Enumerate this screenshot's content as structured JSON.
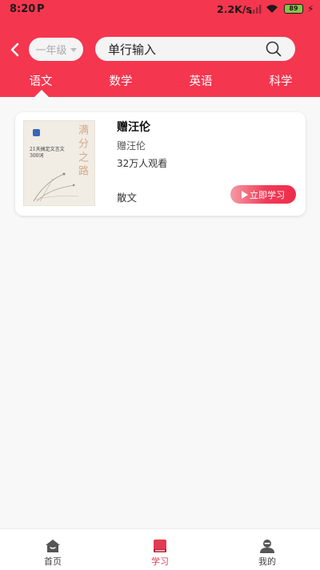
{
  "status_bar": {
    "time": "8:20",
    "carrier_icon": "P",
    "net_speed": "2.2K/s",
    "battery": "89"
  },
  "header": {
    "back_icon": "chevron-left-icon",
    "grade_select": {
      "value": "一年级"
    },
    "search": {
      "value": "单行输入",
      "icon": "search-icon"
    },
    "tabs": [
      {
        "label": "语文",
        "active": true
      },
      {
        "label": "数学",
        "active": false
      },
      {
        "label": "英语",
        "active": false
      },
      {
        "label": "科学",
        "active": false
      }
    ]
  },
  "course_card": {
    "title": "赠汪伦",
    "author": "赠汪伦",
    "views": "32万人观看",
    "genre": "散文",
    "button_label": "立即学习",
    "cover": {
      "title": "满分之路",
      "subtitle": "21天搞定文言文300词"
    }
  },
  "bottom_nav": [
    {
      "label": "首页",
      "icon": "home-icon",
      "active": false
    },
    {
      "label": "学习",
      "icon": "book-icon",
      "active": true
    },
    {
      "label": "我的",
      "icon": "user-icon",
      "active": false
    }
  ],
  "colors": {
    "accent": "#f5364f",
    "active_nav": "#e23a52",
    "background": "#f8f8f8"
  }
}
